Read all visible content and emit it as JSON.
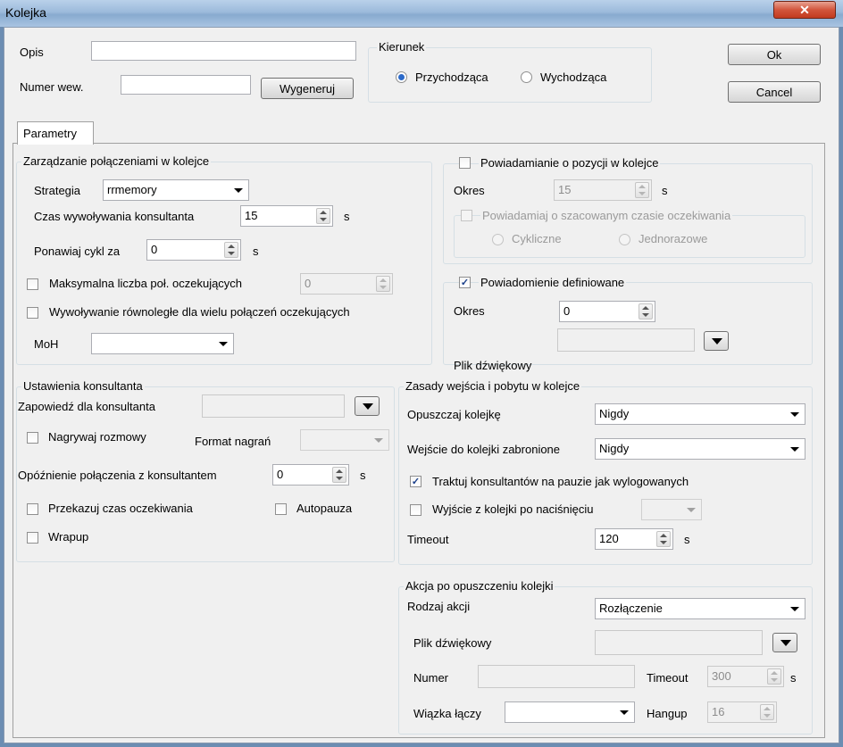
{
  "window": {
    "title": "Kolejka",
    "close_glyph": "✕"
  },
  "header": {
    "opis_label": "Opis",
    "opis_value": "",
    "numer_label": "Numer wew.",
    "numer_value": "",
    "wygeneruj": "Wygeneruj",
    "kierunek_title": "Kierunek",
    "radio_przychodzaca": "Przychodząca",
    "radio_wychodzaca": "Wychodząca",
    "selected_direction": "Przychodząca",
    "ok": "Ok",
    "cancel": "Cancel"
  },
  "tab": {
    "label": "Parametry"
  },
  "zarzadzanie": {
    "title": "Zarządzanie połączeniami w kolejce",
    "strategia_label": "Strategia",
    "strategia_value": "rrmemory",
    "czas_label": "Czas wywoływania konsultanta",
    "czas_value": "15",
    "czas_unit": "s",
    "ponawiaj_label": "Ponawiaj cykl za",
    "ponawiaj_value": "0",
    "ponawiaj_unit": "s",
    "maks_label": "Maksymalna liczba poł. oczekujących",
    "maks_checked": false,
    "maks_value": "0",
    "rownolegle_label": "Wywoływanie równoległe dla wielu połączeń oczekujących",
    "rownolegle_checked": false,
    "moh_label": "MoH",
    "moh_value": ""
  },
  "powiadamianie_pozycji": {
    "title": "Powiadamianie o pozycji w kolejce",
    "checked": false,
    "okres_label": "Okres",
    "okres_value": "15",
    "okres_unit": "s",
    "szacowany_label": "Powiadamiaj o szacowanym czasie oczekiwania",
    "szacowany_checked": false,
    "cykliczne": "Cykliczne",
    "jednorazowe": "Jednorazowe"
  },
  "powiadomienie_def": {
    "title": "Powiadomienie definiowane",
    "checked": true,
    "okres_label": "Okres",
    "okres_value": "0",
    "plik_label": "Plik dźwiękowy",
    "plik_value": ""
  },
  "konsultant": {
    "title": "Ustawienia konsultanta",
    "zapowiedz_label": "Zapowiedź dla konsultanta",
    "zapowiedz_value": "",
    "nagrywaj_label": "Nagrywaj rozmowy",
    "nagrywaj_checked": false,
    "format_label": "Format nagrań",
    "format_value": "",
    "opoznienie_label": "Opóźnienie połączenia z konsultantem",
    "opoznienie_value": "0",
    "opoznienie_unit": "s",
    "przekazuj_label": "Przekazuj czas oczekiwania",
    "przekazuj_checked": false,
    "autopauza_label": "Autopauza",
    "autopauza_checked": false,
    "wrapup_label": "Wrapup",
    "wrapup_checked": false
  },
  "zasady": {
    "title": "Zasady wejścia i pobytu w kolejce",
    "opuszczaj_label": "Opuszczaj kolejkę",
    "opuszczaj_value": "Nigdy",
    "wejscie_label": "Wejście do kolejki zabronione",
    "wejscie_value": "Nigdy",
    "traktuj_label": "Traktuj konsultantów na pauzie jak wylogowanych",
    "traktuj_checked": true,
    "wyjscie_label": "Wyjście z kolejki po naciśnięciu",
    "wyjscie_checked": false,
    "wyjscie_value": "",
    "timeout_label": "Timeout",
    "timeout_value": "120",
    "timeout_unit": "s"
  },
  "akcja": {
    "title": "Akcja po opuszczeniu kolejki",
    "rodzaj_label": "Rodzaj akcji",
    "rodzaj_value": "Rozłączenie",
    "plik_label": "Plik dźwiękowy",
    "plik_value": "",
    "numer_label": "Numer",
    "numer_value": "",
    "timeout_label": "Timeout",
    "timeout_value": "300",
    "timeout_unit": "s",
    "wiazka_label": "Wiązka łączy",
    "wiazka_value": "",
    "hangup_label": "Hangup",
    "hangup_value": "16"
  },
  "colors": {
    "title_bar": "#9cbadb",
    "close_button": "#c94a30",
    "dialog_bg": "#f0f0f0",
    "check_mark": "#1a3f8a"
  }
}
